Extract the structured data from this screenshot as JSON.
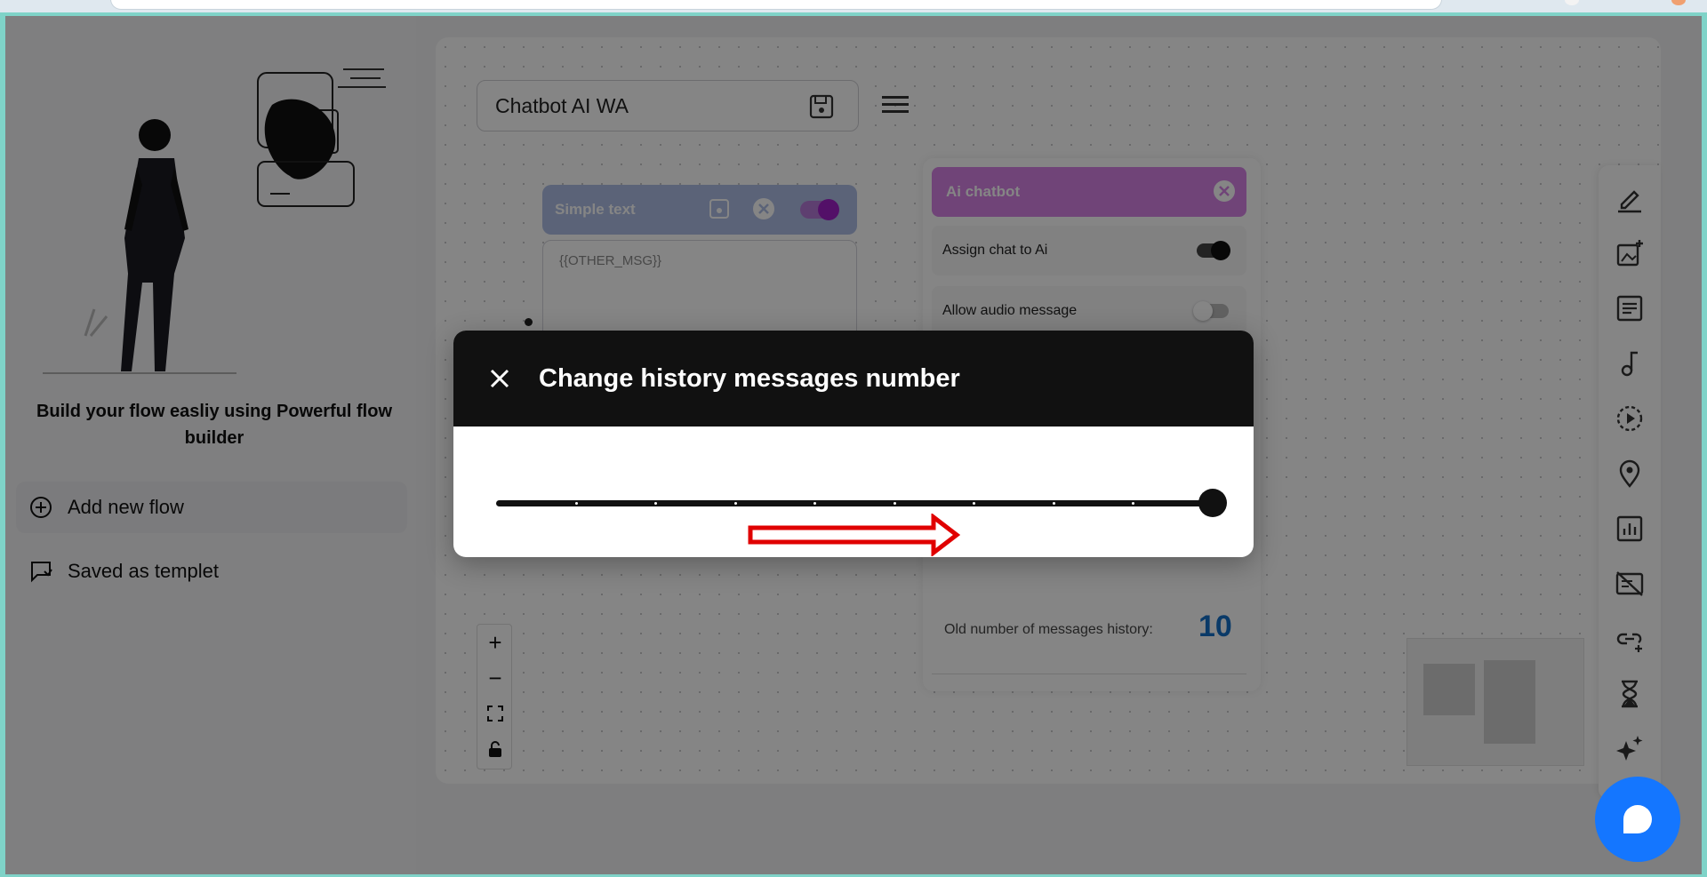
{
  "sidebar": {
    "caption": "Build your flow easliy using Powerful flow builder",
    "items": [
      {
        "label": "Add new flow",
        "icon": "add-circle-icon"
      },
      {
        "label": "Saved as templet",
        "icon": "template-icon"
      }
    ]
  },
  "canvas": {
    "flow_name": "Chatbot AI WA",
    "simple_node": {
      "title": "Simple text",
      "body": "{{OTHER_MSG}}"
    },
    "ai_node": {
      "title": "Ai chatbot",
      "rows": [
        {
          "label": "Assign chat to Ai",
          "enabled": true
        },
        {
          "label": "Allow audio message",
          "enabled": false
        }
      ],
      "old_history_label": "Old number of messages history:",
      "old_history_value": "10"
    },
    "zoom_controls": [
      "+",
      "−",
      "fit",
      "lock"
    ],
    "tools": [
      "edit-icon",
      "add-image-icon",
      "text-icon",
      "music-icon",
      "video-icon",
      "location-icon",
      "poll-icon",
      "disable-message-icon",
      "link-icon",
      "hourglass-icon",
      "ai-sparkle-icon"
    ]
  },
  "modal": {
    "title": "Change history messages number",
    "slider": {
      "min": 0,
      "max": 9,
      "value": 9,
      "steps": 9
    }
  },
  "colors": {
    "ai_header": "#d682e6",
    "simple_header": "#aebfe6",
    "accent_blue": "#1476ff",
    "history_value": "#1470c8"
  }
}
